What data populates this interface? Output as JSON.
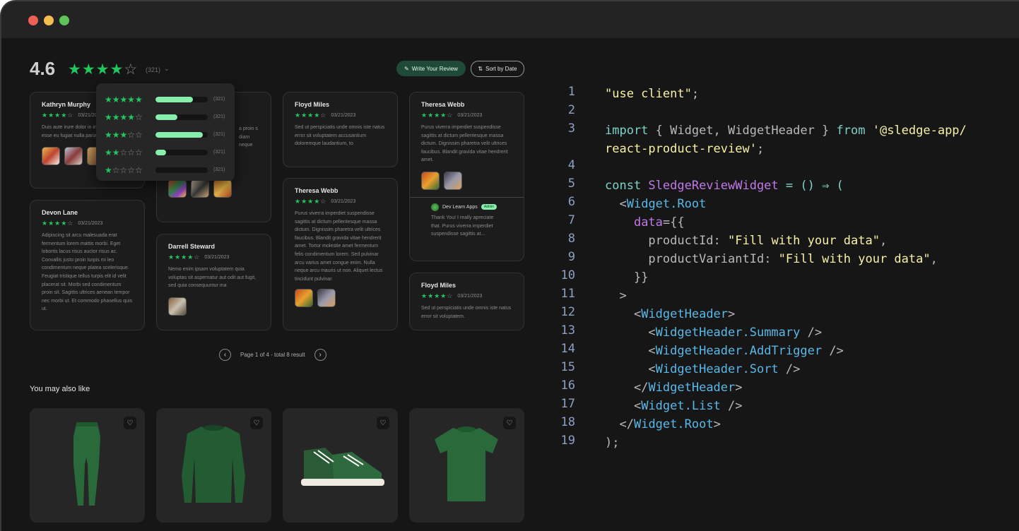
{
  "header": {
    "rating": "4.6",
    "stars": "★★★★",
    "star_empty": "☆",
    "count": "(321)",
    "write_label": "Write Your Review",
    "sort_label": "Sort by Date"
  },
  "popover": {
    "rows": [
      {
        "filled": "★★★★★",
        "empty": "",
        "count": "(321)",
        "fill_pct": 0.72
      },
      {
        "filled": "★★★★",
        "empty": "☆",
        "count": "(321)",
        "fill_pct": 0.42
      },
      {
        "filled": "★★★",
        "empty": "☆☆",
        "count": "(321)",
        "fill_pct": 0.9
      },
      {
        "filled": "★★",
        "empty": "☆☆☆",
        "count": "(321)",
        "fill_pct": 0.2
      },
      {
        "filled": "★",
        "empty": "☆☆☆☆",
        "count": "(321)",
        "fill_pct": 0.0
      }
    ]
  },
  "reviews": [
    {
      "name": "Kathryn Murphy",
      "date": "03/21/2023",
      "body": "Duis aute irure dolor in in voluptate velit esse eu fugiat nulla pariatur"
    },
    {
      "name": "",
      "date": "",
      "body": "a proin s diam neque"
    },
    {
      "name": "Floyd Miles",
      "date": "03/21/2023",
      "body": "Sed ut perspiciatis unde omnis iste natus error sit voluptatem accusantium doloremque laudantium, to"
    },
    {
      "name": "Theresa Webb",
      "date": "03/21/2023",
      "body": "Purus viverra imperdiet suspendisse sagittis at dictum pellentesque massa dictum. Dignissim pharetra velit ultrices faucibus. Blandit gravida vitae hendrerit amet."
    },
    {
      "name": "Devon Lane",
      "date": "03/21/2023",
      "body": "Adipiscing sit arcu malesuada erat fermentum lorem mattis morbi. Eget lobortis lacus risus auctor risus ac. Convallis justo proin turpis mi leo condimentum neque platea scelerisque. Feugiat tristique tellus turpis elit id velit placerat sit. Morbi sed condimentum proin sit. Sagittis ultrices aenean tempor nec morbi ut. Et commodo phasellus quis ut."
    },
    {
      "name": "Darrell Steward",
      "date": "03/21/2023",
      "body": "Nemo enim ipsam voluptatem quia voluptas sit aspernatur aut odit aut fugit, sed quia consequuntur ma"
    },
    {
      "name": "Theresa Webb",
      "date": "03/21/2023",
      "body": "Purus viverra imperdiet suspendisse sagittis at dictum pellentesque massa dictum. Dignissim pharetra velit ultrices faucibus. Blandit gravida vitae hendrerit amet. Tortor molestie amet fermentum felis condimentum lorem. Sed pulvinar arcu varius amet congue enim. Nulla neque arcu mauris ut non. Aliquet lectus tincidunt pulvinar."
    },
    {
      "name": "Floyd Miles",
      "date": "03/21/2023",
      "body": "Sed ut perspiciatis unde omnis iste natus error sit voluptatem."
    }
  ],
  "reply": {
    "name": "Dev Learn Apps",
    "badge": "Admin",
    "body": "Thank You! I really apreciate that. Purus viverra imperdiet suspendisse sagittis at..."
  },
  "pager": {
    "prev": "‹",
    "text": "Page 1 of 4 - total 8 result",
    "next": "›"
  },
  "also": {
    "title": "You may also like",
    "heart": "♡"
  },
  "code": {
    "lines": [
      {
        "n": "1"
      },
      {
        "n": "2"
      },
      {
        "n": "3"
      },
      {
        "n": "4"
      },
      {
        "n": "5"
      },
      {
        "n": "6"
      },
      {
        "n": "7"
      },
      {
        "n": "8"
      },
      {
        "n": "9"
      },
      {
        "n": "10"
      },
      {
        "n": "11"
      },
      {
        "n": "12"
      },
      {
        "n": "13"
      },
      {
        "n": "14"
      },
      {
        "n": "15"
      },
      {
        "n": "16"
      },
      {
        "n": "17"
      },
      {
        "n": "18"
      },
      {
        "n": "19"
      }
    ],
    "t": {
      "l1": "\"use client\"",
      "semi": ";",
      "import": "import",
      "l3_brace": " { Widget, WidgetHeader } ",
      "from": "from",
      "pkg1": " '@sledge-app/",
      "pkg2": "react-product-review'",
      "const": "const",
      "comp": " SledgeReviewWidget",
      "arrow": " = () ⇒ (",
      "wroot": "Widget.Root",
      "lt": "<",
      "gt": ">",
      "data": "data",
      "eqbrace": "={{",
      "pid": "productId",
      "colon": ": ",
      "fill": "\"Fill with your data\"",
      "comma": ",",
      "pvid": "productVariantId",
      "close2": "}}",
      "wh": "WidgetHeader",
      "whs": "WidgetHeader.Summary",
      "wha": "WidgetHeader.AddTrigger",
      "whso": "WidgetHeader.Sort",
      "selfclose": " />",
      "lts": "</",
      "wl": "Widget.List",
      "paren": ");"
    }
  }
}
